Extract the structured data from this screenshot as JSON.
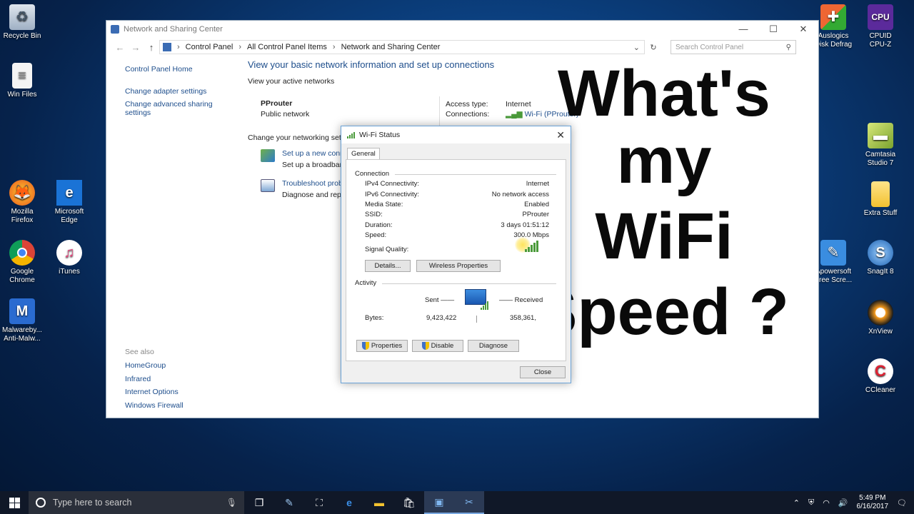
{
  "desktop_left": [
    {
      "label": "Recycle Bin",
      "icon": "recycle-bin-icon"
    },
    {
      "label": "Win Files",
      "icon": "document-icon"
    },
    {
      "label": "Mozilla\nFirefox",
      "icon": "firefox-icon"
    },
    {
      "label": "Microsoft\nEdge",
      "icon": "edge-icon"
    },
    {
      "label": "Google\nChrome",
      "icon": "chrome-icon"
    },
    {
      "label": "iTunes",
      "icon": "itunes-icon"
    },
    {
      "label": "Malwareby...\nAnti-Malw...",
      "icon": "malwarebytes-icon"
    }
  ],
  "desktop_right": [
    {
      "label": "Auslogics\nDisk Defrag",
      "icon": "auslogics-icon"
    },
    {
      "label": "CPUID\nCPU-Z",
      "icon": "cpuz-icon"
    },
    {
      "label": "Camtasia\nStudio 7",
      "icon": "camtasia-icon"
    },
    {
      "label": "Extra Stuff",
      "icon": "folder-icon"
    },
    {
      "label": "Apowersoft\nFree Scre...",
      "icon": "apowersoft-icon"
    },
    {
      "label": "SnagIt 8",
      "icon": "snagit-icon"
    },
    {
      "label": "XnView",
      "icon": "xnview-icon"
    },
    {
      "label": "CCleaner",
      "icon": "ccleaner-icon"
    }
  ],
  "window": {
    "title": "Network and Sharing Center",
    "breadcrumbs": [
      "Control Panel",
      "All Control Panel Items",
      "Network and Sharing Center"
    ],
    "search_placeholder": "Search Control Panel",
    "left_links": {
      "home": "Control Panel Home",
      "adapter": "Change adapter settings",
      "sharing": "Change advanced sharing settings"
    },
    "see_also": {
      "header": "See also",
      "items": [
        "HomeGroup",
        "Infrared",
        "Internet Options",
        "Windows Firewall"
      ]
    },
    "main": {
      "heading": "View your basic network information and set up connections",
      "active_networks": "View your active networks",
      "network_name": "PProuter",
      "network_type": "Public network",
      "access_type_label": "Access type:",
      "access_type_value": "Internet",
      "connections_label": "Connections:",
      "connections_value": "Wi-Fi (PProuter)",
      "change_settings": "Change your networking settings",
      "task1_link": "Set up a new connection or network",
      "task1_desc": "Set up a broadband, dial-up, or VPN connection; or set up a router or access point.",
      "task2_link": "Troubleshoot problems",
      "task2_desc": "Diagnose and repair network problems, or get troubleshooting information."
    }
  },
  "overlay": {
    "line1": "What's",
    "line2": "my",
    "line3": "WiFi",
    "line4": "Speed ?"
  },
  "dialog": {
    "title": "Wi-Fi Status",
    "tab": "General",
    "connection_header": "Connection",
    "rows": [
      {
        "k": "IPv4 Connectivity:",
        "v": "Internet"
      },
      {
        "k": "IPv6 Connectivity:",
        "v": "No network access"
      },
      {
        "k": "Media State:",
        "v": "Enabled"
      },
      {
        "k": "SSID:",
        "v": "PProuter"
      },
      {
        "k": "Duration:",
        "v": "3 days 01:51:12"
      },
      {
        "k": "Speed:",
        "v": "300.0 Mbps"
      }
    ],
    "signal_label": "Signal Quality:",
    "btn_details": "Details...",
    "btn_wireless": "Wireless Properties",
    "activity_header": "Activity",
    "sent_label": "Sent",
    "received_label": "Received",
    "bytes_label": "Bytes:",
    "bytes_sent": "9,423,422",
    "bytes_received": "358,361,",
    "btn_properties": "Properties",
    "btn_disable": "Disable",
    "btn_diagnose": "Diagnose",
    "btn_close": "Close"
  },
  "taskbar": {
    "search_placeholder": "Type here to search",
    "time": "5:49 PM",
    "date": "6/16/2017"
  }
}
